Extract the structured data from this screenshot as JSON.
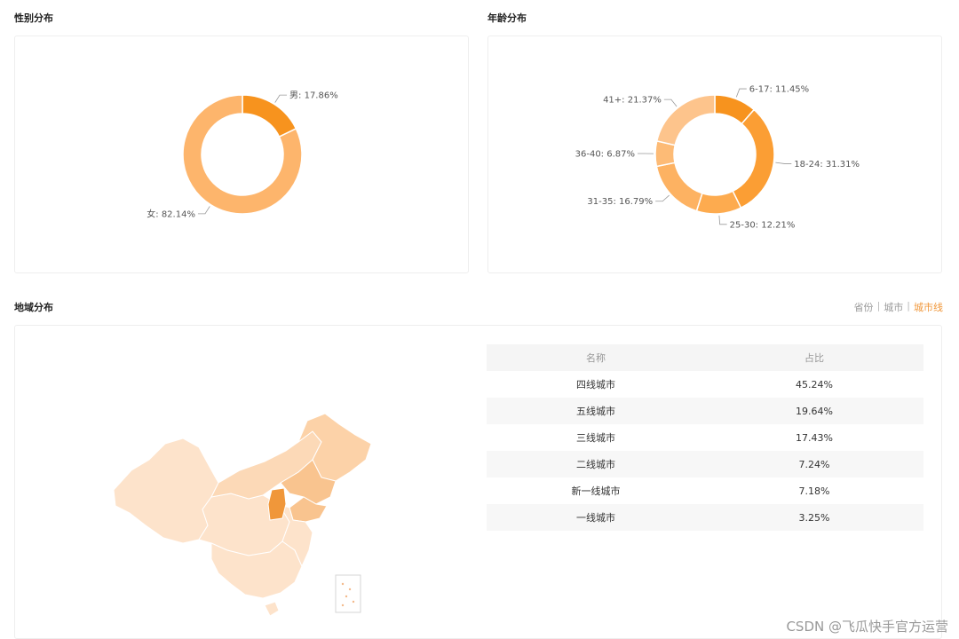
{
  "sections": {
    "gender_title": "性别分布",
    "age_title": "年龄分布",
    "region_title": "地域分布"
  },
  "region_tabs": [
    {
      "label": "省份",
      "active": false
    },
    {
      "label": "城市",
      "active": false
    },
    {
      "label": "城市线",
      "active": true
    }
  ],
  "colors": {
    "accent": "#f0973a",
    "map_base": "#fde3cb",
    "map_mid": "#f9c48f",
    "map_hot": "#f0973a"
  },
  "chart_data": [
    {
      "type": "pie",
      "title": "",
      "slices": [
        {
          "name": "男",
          "value": 17.86,
          "label": "男: 17.86%",
          "color": "#f7931e"
        },
        {
          "name": "女",
          "value": 82.14,
          "label": "女: 82.14%",
          "color": "#fdb56c"
        }
      ]
    },
    {
      "type": "pie",
      "title": "",
      "slices": [
        {
          "name": "6-17",
          "value": 11.45,
          "label": "6-17: 11.45%",
          "color": "#f7931e"
        },
        {
          "name": "18-24",
          "value": 31.31,
          "label": "18-24: 31.31%",
          "color": "#fb9e34"
        },
        {
          "name": "25-30",
          "value": 12.21,
          "label": "25-30: 12.21%",
          "color": "#fdab4f"
        },
        {
          "name": "31-35",
          "value": 16.79,
          "label": "31-35: 16.79%",
          "color": "#fdb262"
        },
        {
          "name": "36-40",
          "value": 6.87,
          "label": "36-40: 6.87%",
          "color": "#fdbb76"
        },
        {
          "name": "41+",
          "value": 21.37,
          "label": "41+: 21.37%",
          "color": "#fdc48c"
        }
      ]
    },
    {
      "type": "table",
      "columns": [
        "名称",
        "占比"
      ],
      "rows": [
        [
          "四线城市",
          "45.24%"
        ],
        [
          "五线城市",
          "19.64%"
        ],
        [
          "三线城市",
          "17.43%"
        ],
        [
          "二线城市",
          "7.24%"
        ],
        [
          "新一线城市",
          "7.18%"
        ],
        [
          "一线城市",
          "3.25%"
        ]
      ]
    }
  ],
  "watermark": "CSDN @飞瓜快手官方运营"
}
